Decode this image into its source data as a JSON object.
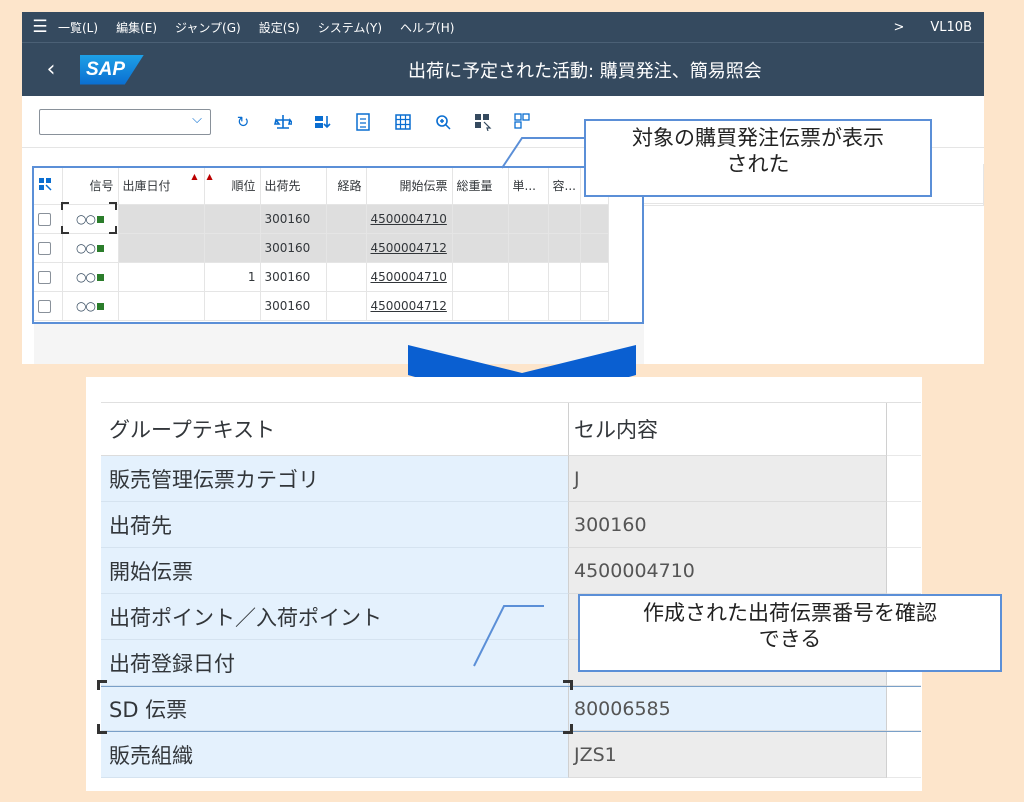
{
  "menubar": {
    "items": [
      "一覧(L)",
      "編集(E)",
      "ジャンプ(G)",
      "設定(S)",
      "システム(Y)",
      "ヘルプ(H)"
    ],
    "right_chevron": ">",
    "tcode": "VL10B"
  },
  "titlebar": {
    "title": "出荷に予定された活動: 購買発注、簡易照会",
    "logo_text": "SAP"
  },
  "toolbar": {
    "variant_value": "",
    "icons": [
      "refresh-icon",
      "scale-icon",
      "import-icon",
      "document-icon",
      "grid-icon",
      "zoom-icon",
      "layout-icon",
      "layout-select-icon"
    ],
    "rest_text": "         ✓"
  },
  "grid": {
    "columns": [
      "",
      "信号",
      "出庫日付",
      "順位",
      "出荷先",
      "経路",
      "開始伝票",
      "総重量",
      "単...",
      "容..."
    ],
    "rows": [
      {
        "priority": "",
        "ship_to": "300160",
        "doc": "4500004710"
      },
      {
        "priority": "",
        "ship_to": "300160",
        "doc": "4500004712"
      },
      {
        "priority": "1",
        "ship_to": "300160",
        "doc": "4500004710"
      },
      {
        "priority": "",
        "ship_to": "300160",
        "doc": "4500004712"
      }
    ]
  },
  "callout_top": {
    "line1": "対象の購買発注伝票が表示",
    "line2": "された"
  },
  "detail": {
    "header": {
      "col1": "グループテキスト",
      "col2": "セル内容"
    },
    "rows": [
      {
        "label": "販売管理伝票カテゴリ",
        "value": "J"
      },
      {
        "label": "出荷先",
        "value": "300160"
      },
      {
        "label": "開始伝票",
        "value": "4500004710"
      },
      {
        "label": "出荷ポイント／入荷ポイント",
        "value": ""
      },
      {
        "label": "出荷登録日付",
        "value": ""
      },
      {
        "label": "SD 伝票",
        "value": "80006585"
      },
      {
        "label": "販売組織",
        "value": "JZS1"
      }
    ]
  },
  "callout_bottom": {
    "line1": "作成された出荷伝票番号を確認",
    "line2": "できる"
  },
  "colors": {
    "shell": "#354a5f",
    "accent": "#0a6ed1",
    "callout_border": "#5b8fd7",
    "chevron": "#0a5fd1",
    "background": "#fde5cb"
  }
}
